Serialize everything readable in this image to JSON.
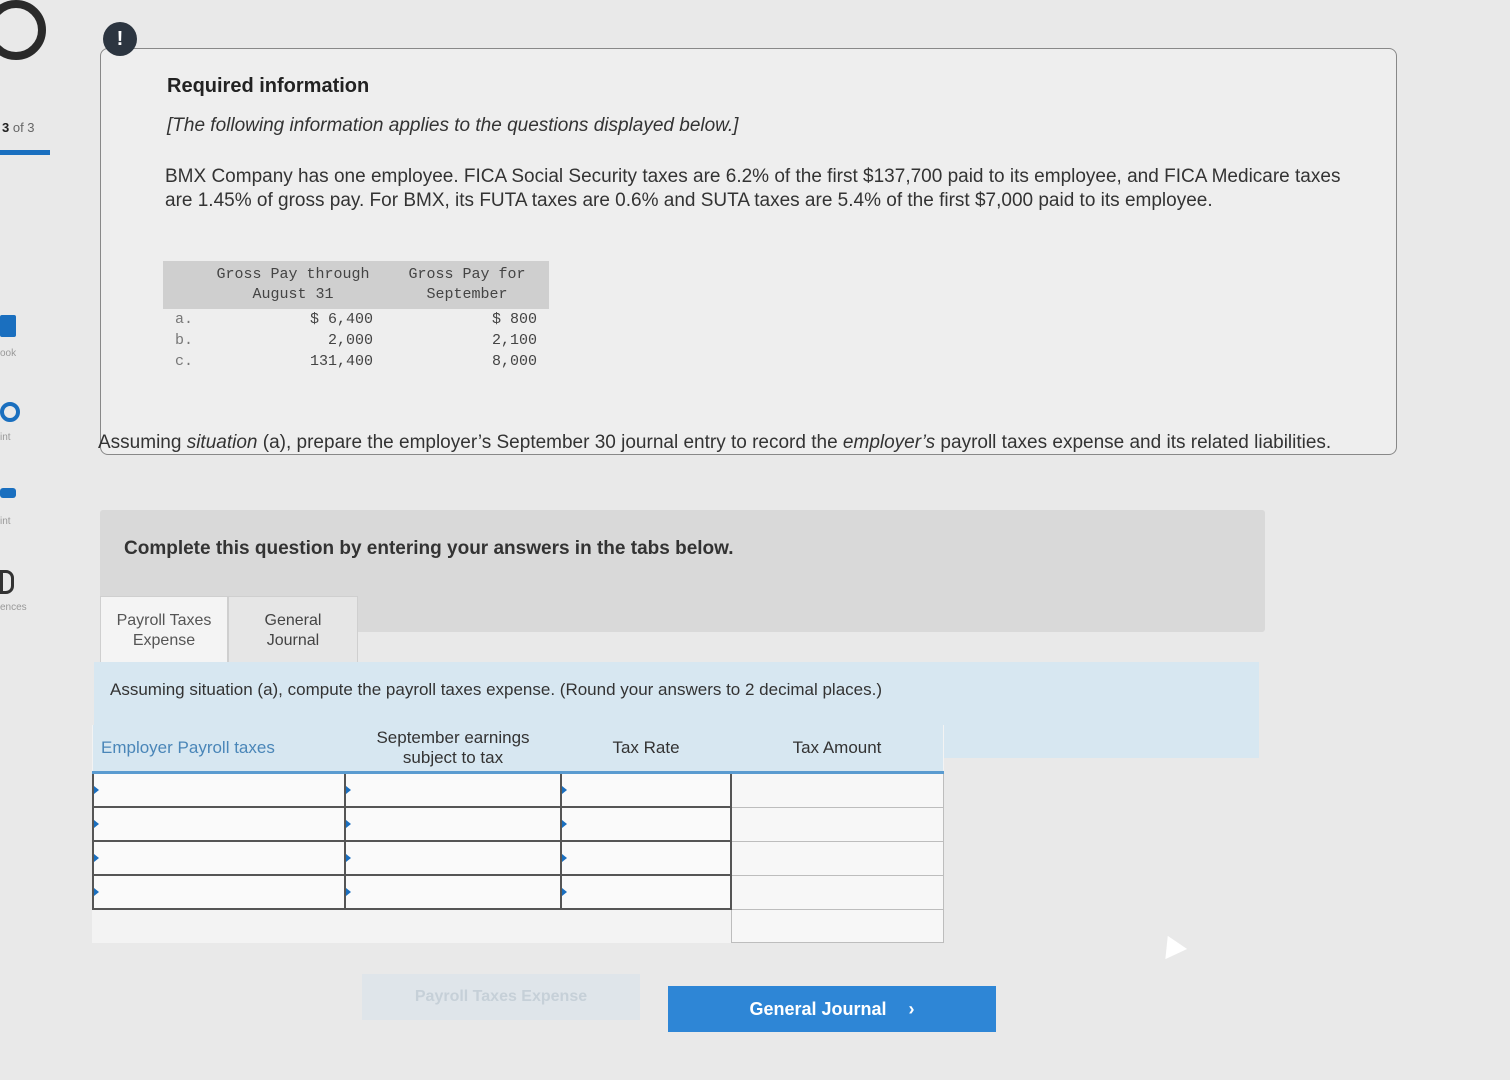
{
  "sidebar": {
    "progress_num": "3",
    "progress_rest": " of 3",
    "items": [
      "ook",
      "int",
      "int",
      "ences"
    ]
  },
  "alert": {
    "glyph": "!"
  },
  "info": {
    "title": "Required information",
    "note": "[The following information applies to the questions displayed below.]",
    "paragraph": "BMX Company has one employee. FICA Social Security taxes are 6.2% of the first $137,700 paid to its employee, and FICA Medicare taxes are 1.45% of gross pay. For BMX, its FUTA taxes are 0.6% and SUTA taxes are 5.4% of the first $7,000 paid to its employee.",
    "table": {
      "headers": [
        "Gross Pay through August 31",
        "Gross Pay for September"
      ],
      "rows": [
        {
          "label": "a.",
          "through": "$ 6,400",
          "september": "$ 800"
        },
        {
          "label": "b.",
          "through": "2,000",
          "september": "2,100"
        },
        {
          "label": "c.",
          "through": "131,400",
          "september": "8,000"
        }
      ]
    }
  },
  "question": {
    "part1": "Assuming ",
    "situation_word": "situation",
    "part2": " (a), prepare the employer’s September 30 journal entry to record the ",
    "employers_word": "employer’s",
    "part3": " payroll taxes expense and its related liabilities."
  },
  "complete": {
    "text": "Complete this question by entering your answers in the tabs below."
  },
  "tabs": [
    {
      "label": "Payroll Taxes Expense"
    },
    {
      "label": "General Journal"
    }
  ],
  "instructions": "Assuming situation (a), compute the payroll taxes expense. (Round your answers to 2 decimal places.)",
  "tax_table": {
    "headers": [
      "Employer Payroll taxes",
      "September earnings subject to tax",
      "Tax Rate",
      "Tax Amount"
    ]
  },
  "buttons": {
    "prev_label": "Payroll Taxes Expense",
    "next_label": "General Journal",
    "next_chevron": "›"
  },
  "colors": {
    "accent": "#2e86d6",
    "header_blue": "#d7e7f1"
  }
}
